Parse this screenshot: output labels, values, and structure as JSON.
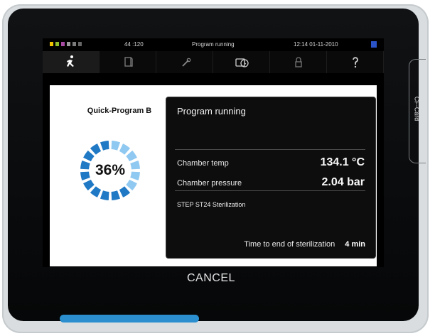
{
  "statusbar": {
    "left_value": "44 :120",
    "center": "Program running",
    "right": "12:14  01-11-2010"
  },
  "tabs": [
    {
      "icon": "running-person-icon"
    },
    {
      "icon": "document-icon"
    },
    {
      "icon": "wrench-icon"
    },
    {
      "icon": "document-clock-icon"
    },
    {
      "icon": "lock-icon"
    },
    {
      "icon": "help-icon"
    }
  ],
  "program": {
    "name": "Quick-Program B",
    "progress_percent": "36%",
    "progress_value": 36
  },
  "panel": {
    "title": "Program running",
    "chamber_temp_label": "Chamber temp",
    "chamber_temp_value": "134.1 °C",
    "chamber_pressure_label": "Chamber pressure",
    "chamber_pressure_value": "2.04 bar",
    "step": "STEP ST24  Sterilization",
    "remaining_label": "Time to end of sterilization",
    "remaining_value": "4 min"
  },
  "cancel_label": "CANCEL",
  "cf_card_label": "CF-Card",
  "colors": {
    "accent_blue": "#2b8fcf",
    "gauge_dark": "#1f79c5",
    "gauge_light": "#8fc8f1"
  }
}
